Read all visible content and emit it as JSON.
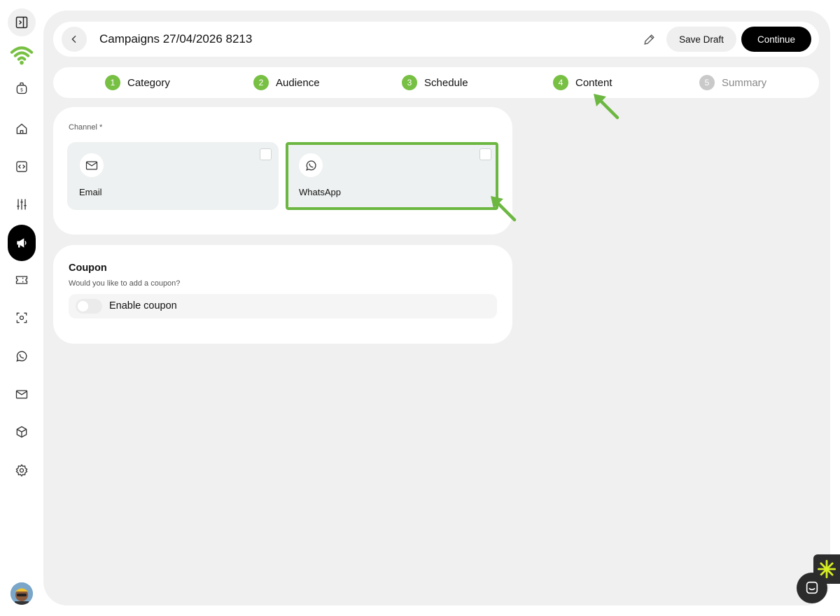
{
  "header": {
    "title": "Campaigns 27/04/2026 8213",
    "save_label": "Save Draft",
    "continue_label": "Continue"
  },
  "steps": [
    {
      "num": "1",
      "label": "Category",
      "status": "done"
    },
    {
      "num": "2",
      "label": "Audience",
      "status": "done"
    },
    {
      "num": "3",
      "label": "Schedule",
      "status": "done"
    },
    {
      "num": "4",
      "label": "Content",
      "status": "current"
    },
    {
      "num": "5",
      "label": "Summary",
      "status": "pending"
    }
  ],
  "channel": {
    "label": "Channel *",
    "options": [
      {
        "label": "Email",
        "icon": "mail-icon",
        "checked": false
      },
      {
        "label": "WhatsApp",
        "icon": "whatsapp-icon",
        "checked": false
      }
    ]
  },
  "coupon": {
    "title": "Coupon",
    "subtitle": "Would you like to add a coupon?",
    "toggle_label": "Enable coupon",
    "enabled": false
  },
  "sidebar": {
    "items": [
      "sidebar-toggle-icon",
      "brand-logo-icon",
      "billing-icon",
      "home-icon",
      "code-icon",
      "sliders-icon",
      "megaphone-icon",
      "ticket-icon",
      "scan-icon",
      "whatsapp-icon",
      "mail-icon",
      "box-icon",
      "settings-icon"
    ],
    "active": "megaphone-icon"
  },
  "colors": {
    "accent_green": "#77c043",
    "highlight_green": "#6cb741",
    "primary": "#000000",
    "panel_bg": "#f0f0f0"
  }
}
